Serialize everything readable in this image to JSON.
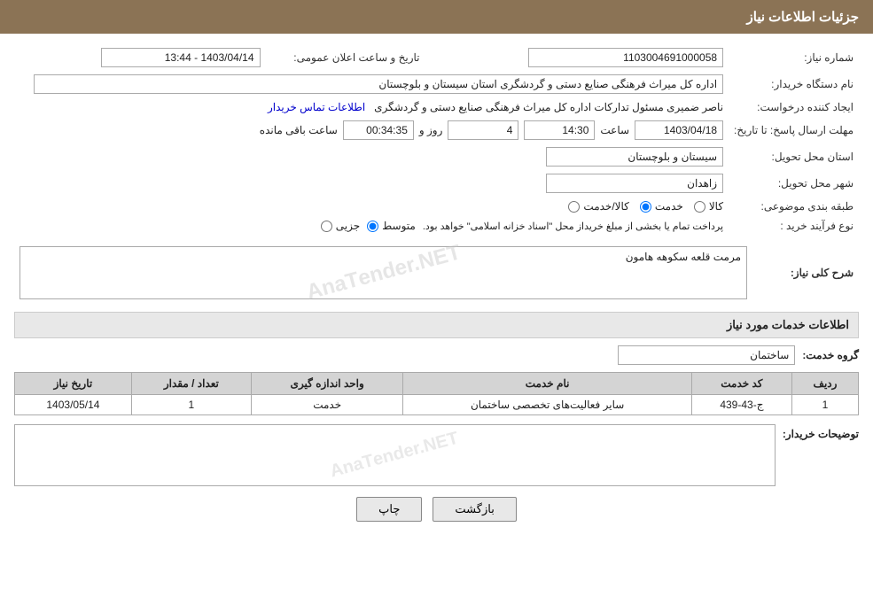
{
  "header": {
    "title": "جزئیات اطلاعات نیاز"
  },
  "info": {
    "shomara_label": "شماره نیاز:",
    "shomara_value": "1103004691000058",
    "tarikh_label": "تاریخ و ساعت اعلان عمومی:",
    "tarikh_value": "1403/04/14 - 13:44",
    "nam_dastgah_label": "نام دستگاه خریدار:",
    "nam_dastgah_value": "اداره کل میراث فرهنگی  صنایع دستی و گردشگری استان سیستان و بلوچستان",
    "ijad_label": "ایجاد کننده درخواست:",
    "ijad_value": "ناصر ضمیری مسئول تدارکات اداره کل میراث فرهنگی  صنایع دستی و گردشگری",
    "ijad_link": "اطلاعات تماس خریدار",
    "mohlat_label": "مهلت ارسال پاسخ: تا تاریخ:",
    "mohlat_date": "1403/04/18",
    "mohlat_time_label": "ساعت",
    "mohlat_time": "14:30",
    "mohlat_roz_label": "روز و",
    "mohlat_roz": "4",
    "mohlat_baqi_label": "ساعت باقی مانده",
    "mohlat_countdown": "00:34:35",
    "ostan_label": "استان محل تحویل:",
    "ostan_value": "سیستان و بلوچستان",
    "shahr_label": "شهر محل تحویل:",
    "shahr_value": "زاهدان",
    "tabaghebandi_label": "طبقه بندی موضوعی:",
    "radio_kala": "کالا",
    "radio_khedmat": "خدمت",
    "radio_kala_khedmat": "کالا/خدمت",
    "selected_radio": "khedmat",
    "nooe_farayand_label": "نوع فرآیند خرید :",
    "radio_jozii": "جزیی",
    "radio_motevaset": "متوسط",
    "farayand_note": "پرداخت تمام یا بخشی از مبلغ خریداز محل \"اسناد خزانه اسلامی\" خواهد بود.",
    "selected_farayand": "motevaset"
  },
  "sharh": {
    "label": "شرح کلی نیاز:",
    "value": "مرمت قلعه سکوهه هامون"
  },
  "services": {
    "title": "اطلاعات خدمات مورد نیاز",
    "group_label": "گروه خدمت:",
    "group_value": "ساختمان",
    "table": {
      "headers": [
        "ردیف",
        "کد خدمت",
        "نام خدمت",
        "واحد اندازه گیری",
        "تعداد / مقدار",
        "تاریخ نیاز"
      ],
      "rows": [
        {
          "row": "1",
          "code": "ج-43-439",
          "name": "سایر فعالیت‌های تخصصی ساختمان",
          "unit": "خدمت",
          "count": "1",
          "date": "1403/05/14"
        }
      ]
    }
  },
  "buyer_desc": {
    "label": "توضیحات خریدار:"
  },
  "buttons": {
    "print": "چاپ",
    "back": "بازگشت"
  }
}
